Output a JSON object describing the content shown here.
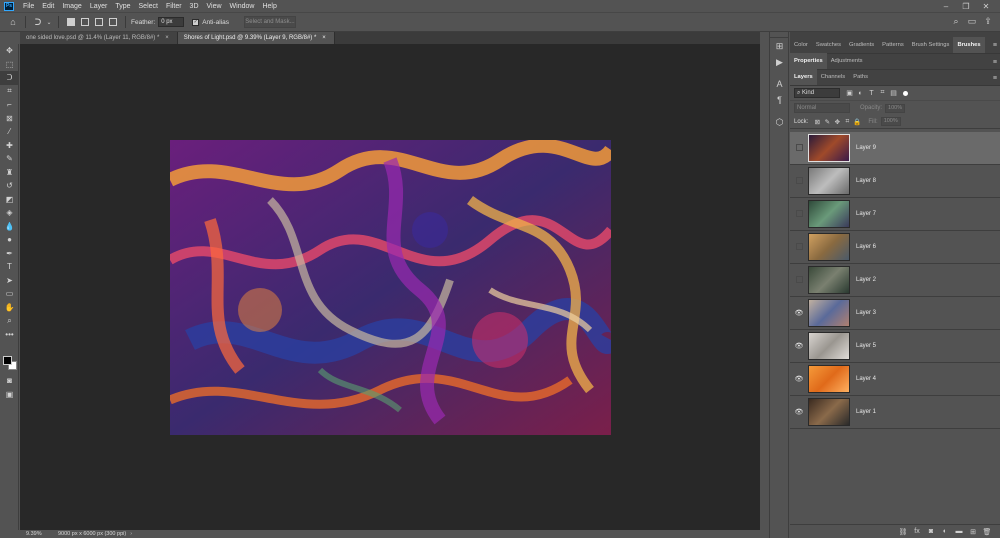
{
  "app": {
    "logo": "Ps"
  },
  "menu": [
    "File",
    "Edit",
    "Image",
    "Layer",
    "Type",
    "Select",
    "Filter",
    "3D",
    "View",
    "Window",
    "Help"
  ],
  "window_controls": [
    "–",
    "❐",
    "✕"
  ],
  "options_bar": {
    "feather_label": "Feather:",
    "feather_value": "0 px",
    "antialias_label": "Anti-alias",
    "select_mask_label": "Select and Mask..."
  },
  "tabs": [
    {
      "label": "one sided love.psd @ 11.4% (Layer 11, RGB/8#) *",
      "close": "×"
    },
    {
      "label": "Shores of Light.psd @ 9.39% (Layer 9, RGB/8#) *",
      "close": "×"
    }
  ],
  "status": {
    "zoom": "9.39%",
    "doc_info": "9000 px x 6000 px (300 ppi)",
    "arrow": "›"
  },
  "panel_tabs_top": [
    "Color",
    "Swatches",
    "Gradients",
    "Patterns",
    "Brush Settings",
    "Brushes"
  ],
  "panel_tabs_mid": [
    "Properties",
    "Adjustments"
  ],
  "panel_tabs_layers": [
    "Layers",
    "Channels",
    "Paths"
  ],
  "layers_panel": {
    "kind_label": "Kind",
    "blend_mode": "Normal",
    "opacity_label": "Opacity:",
    "opacity_value": "100%",
    "lock_label": "Lock:",
    "fill_label": "Fill:",
    "fill_value": "100%"
  },
  "layers": [
    {
      "name": "Layer 9",
      "visible": false,
      "selected": true,
      "thumb_color": "#7a3a2a"
    },
    {
      "name": "Layer 8",
      "visible": false,
      "selected": false,
      "thumb_color": "#9a9a9a"
    },
    {
      "name": "Layer 7",
      "visible": false,
      "selected": false,
      "thumb_color": "#4f6d58"
    },
    {
      "name": "Layer 6",
      "visible": false,
      "selected": false,
      "thumb_color": "#b08a50"
    },
    {
      "name": "Layer 2",
      "visible": false,
      "selected": false,
      "thumb_color": "#56604f"
    },
    {
      "name": "Layer 3",
      "visible": true,
      "selected": false,
      "thumb_color": "#8a8fa0"
    },
    {
      "name": "Layer 5",
      "visible": true,
      "selected": false,
      "thumb_color": "#b9b6b2"
    },
    {
      "name": "Layer 4",
      "visible": true,
      "selected": false,
      "thumb_color": "#f07a22"
    },
    {
      "name": "Layer 1",
      "visible": true,
      "selected": false,
      "thumb_color": "#5b4a3a"
    }
  ],
  "colors": {
    "accent": "#31a8ff",
    "canvas_bg": "#282828",
    "ui_bg": "#535353"
  }
}
